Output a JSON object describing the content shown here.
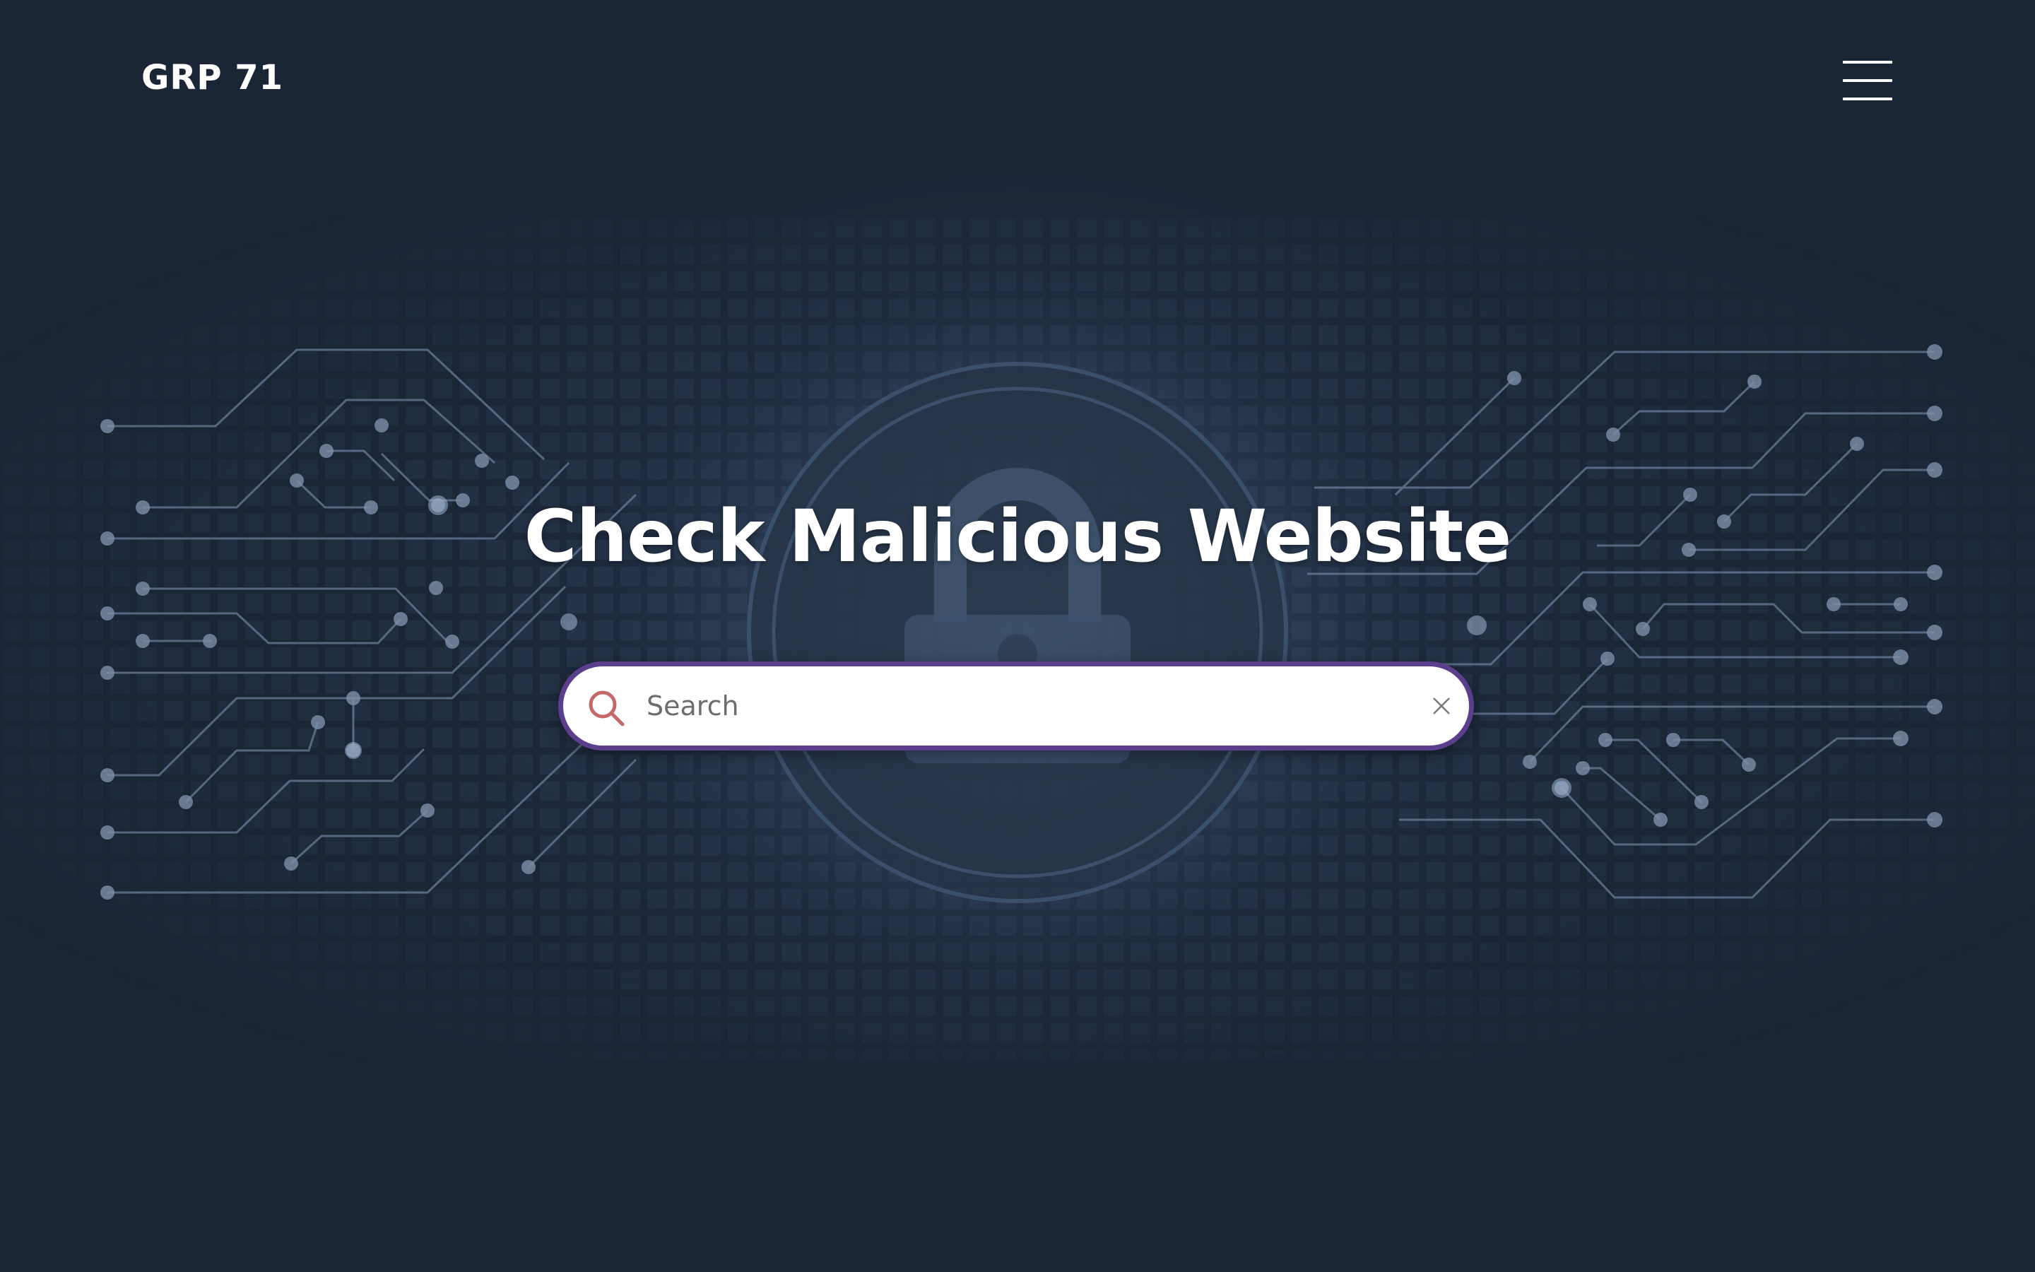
{
  "header": {
    "brand": "GRP 71",
    "menu_icon": "hamburger-menu-icon"
  },
  "hero": {
    "title": "Check Malicious Website",
    "background_icons": [
      "padlock-icon",
      "circuit-lines"
    ]
  },
  "search": {
    "value": "",
    "placeholder": "Search",
    "icon": "search-icon",
    "clear_icon": "close-icon"
  },
  "colors": {
    "background": "#1b2638",
    "search_border": "#5b3f8c",
    "search_icon": "#c4696a",
    "text": "#ffffff"
  }
}
